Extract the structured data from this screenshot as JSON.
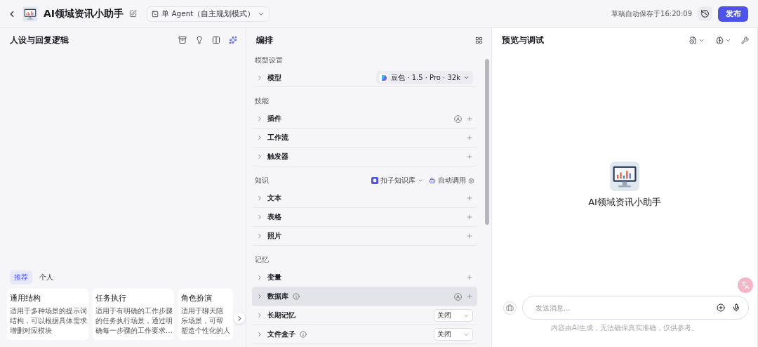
{
  "header": {
    "bot_name": "AI领域资讯小助手",
    "mode_label": "单 Agent（自主规划模式）",
    "autosave": "草稿自动保存于16:20:09",
    "publish": "发布"
  },
  "persona_panel": {
    "title": "人设与回复逻辑",
    "template_tabs": [
      {
        "label": "推荐",
        "selected": true
      },
      {
        "label": "个人",
        "selected": false
      }
    ],
    "templates": [
      {
        "title": "通用结构",
        "lines": [
          "适用于多种场景的提示词",
          "结构，可以根据具体需求",
          "增删对应模块"
        ]
      },
      {
        "title": "任务执行",
        "lines": [
          "适用于有明确的工作步骤",
          "的任务执行场景，通过明",
          "确每一步骤的工作要求…"
        ]
      },
      {
        "title": "角色扮演",
        "lines": [
          "适用于聊天陪",
          "乐场景，可帮",
          "塑造个性化的人"
        ]
      }
    ]
  },
  "arrange_panel": {
    "title": "编排",
    "sections": [
      {
        "heading": "模型设置",
        "rows": [
          {
            "label": "模型",
            "kind": "model",
            "value": "豆包 · 1.5 · Pro · 32k",
            "info": false,
            "auto": false,
            "highlighted": false
          }
        ]
      },
      {
        "heading": "技能",
        "rows": [
          {
            "label": "插件",
            "kind": "add",
            "info": false,
            "auto": true,
            "highlighted": false
          },
          {
            "label": "工作流",
            "kind": "add",
            "info": false,
            "auto": false,
            "highlighted": false
          },
          {
            "label": "触发器",
            "kind": "add",
            "info": false,
            "auto": false,
            "highlighted": false
          }
        ]
      },
      {
        "heading": "知识",
        "extras": [
          {
            "kind": "kb-select",
            "label": "扣子知识库"
          },
          {
            "kind": "auto-call",
            "label": "自动调用"
          }
        ],
        "rows": [
          {
            "label": "文本",
            "kind": "add",
            "info": false,
            "auto": false,
            "highlighted": false
          },
          {
            "label": "表格",
            "kind": "add",
            "info": false,
            "auto": false,
            "highlighted": false
          },
          {
            "label": "照片",
            "kind": "add",
            "info": false,
            "auto": false,
            "highlighted": false
          }
        ]
      },
      {
        "heading": "记忆",
        "rows": [
          {
            "label": "变量",
            "kind": "add",
            "info": false,
            "auto": false,
            "highlighted": false
          },
          {
            "label": "数据库",
            "kind": "add",
            "info": true,
            "auto": true,
            "highlighted": true
          },
          {
            "label": "长期记忆",
            "kind": "select",
            "value": "关闭",
            "info": false,
            "auto": false,
            "highlighted": false
          },
          {
            "label": "文件盒子",
            "kind": "select",
            "value": "关闭",
            "info": true,
            "auto": false,
            "highlighted": false
          }
        ]
      }
    ]
  },
  "preview_panel": {
    "title": "预览与调试",
    "bot_name": "AI领域资讯小助手",
    "input": {
      "placeholder": "发送消息..."
    },
    "disclaimer": "内容由AI生成，无法确保真实准确，仅供参考。"
  }
}
